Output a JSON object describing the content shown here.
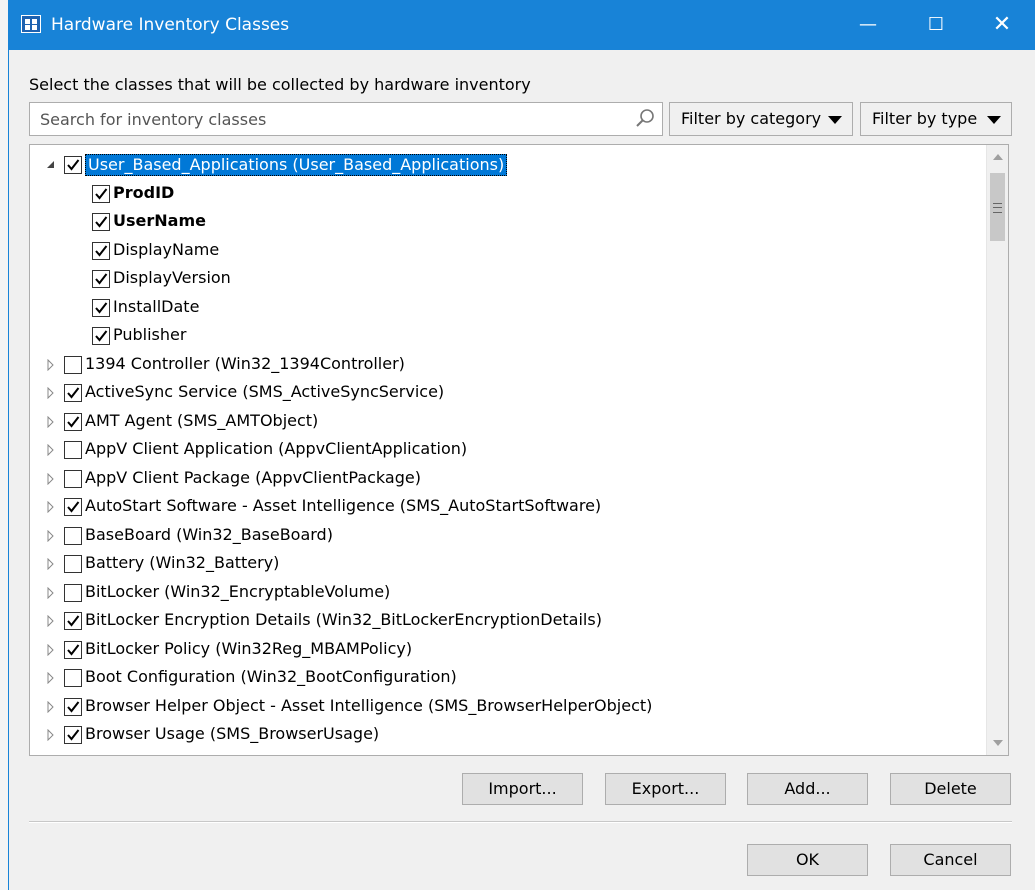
{
  "window": {
    "title": "Hardware Inventory Classes",
    "min_glyph": "—",
    "max_glyph": "☐",
    "close_glyph": "✕"
  },
  "instruction": "Select the classes that will be collected by hardware inventory",
  "search": {
    "placeholder": "Search for inventory classes",
    "value": ""
  },
  "filters": {
    "category_label": "Filter by category",
    "type_label": "Filter by type"
  },
  "tree": {
    "rows": [
      {
        "label": "User_Based_Applications (User_Based_Applications)",
        "checked": true,
        "level": 0,
        "expander": "expanded",
        "selected": true,
        "bold": false
      },
      {
        "label": "ProdID",
        "checked": true,
        "level": 1,
        "expander": "none",
        "selected": false,
        "bold": true
      },
      {
        "label": "UserName",
        "checked": true,
        "level": 1,
        "expander": "none",
        "selected": false,
        "bold": true
      },
      {
        "label": "DisplayName",
        "checked": true,
        "level": 1,
        "expander": "none",
        "selected": false,
        "bold": false
      },
      {
        "label": "DisplayVersion",
        "checked": true,
        "level": 1,
        "expander": "none",
        "selected": false,
        "bold": false
      },
      {
        "label": "InstallDate",
        "checked": true,
        "level": 1,
        "expander": "none",
        "selected": false,
        "bold": false
      },
      {
        "label": "Publisher",
        "checked": true,
        "level": 1,
        "expander": "none",
        "selected": false,
        "bold": false
      },
      {
        "label": "1394 Controller (Win32_1394Controller)",
        "checked": false,
        "level": 0,
        "expander": "collapsed",
        "selected": false,
        "bold": false
      },
      {
        "label": "ActiveSync Service (SMS_ActiveSyncService)",
        "checked": true,
        "level": 0,
        "expander": "collapsed",
        "selected": false,
        "bold": false
      },
      {
        "label": "AMT Agent (SMS_AMTObject)",
        "checked": true,
        "level": 0,
        "expander": "collapsed",
        "selected": false,
        "bold": false
      },
      {
        "label": "AppV Client Application (AppvClientApplication)",
        "checked": false,
        "level": 0,
        "expander": "collapsed",
        "selected": false,
        "bold": false
      },
      {
        "label": "AppV Client Package (AppvClientPackage)",
        "checked": false,
        "level": 0,
        "expander": "collapsed",
        "selected": false,
        "bold": false
      },
      {
        "label": "AutoStart Software - Asset Intelligence (SMS_AutoStartSoftware)",
        "checked": true,
        "level": 0,
        "expander": "collapsed",
        "selected": false,
        "bold": false
      },
      {
        "label": "BaseBoard (Win32_BaseBoard)",
        "checked": false,
        "level": 0,
        "expander": "collapsed",
        "selected": false,
        "bold": false
      },
      {
        "label": "Battery (Win32_Battery)",
        "checked": false,
        "level": 0,
        "expander": "collapsed",
        "selected": false,
        "bold": false
      },
      {
        "label": "BitLocker (Win32_EncryptableVolume)",
        "checked": false,
        "level": 0,
        "expander": "collapsed",
        "selected": false,
        "bold": false
      },
      {
        "label": "BitLocker Encryption Details (Win32_BitLockerEncryptionDetails)",
        "checked": true,
        "level": 0,
        "expander": "collapsed",
        "selected": false,
        "bold": false
      },
      {
        "label": "BitLocker Policy (Win32Reg_MBAMPolicy)",
        "checked": true,
        "level": 0,
        "expander": "collapsed",
        "selected": false,
        "bold": false
      },
      {
        "label": "Boot Configuration (Win32_BootConfiguration)",
        "checked": false,
        "level": 0,
        "expander": "collapsed",
        "selected": false,
        "bold": false
      },
      {
        "label": "Browser Helper Object - Asset Intelligence (SMS_BrowserHelperObject)",
        "checked": true,
        "level": 0,
        "expander": "collapsed",
        "selected": false,
        "bold": false
      },
      {
        "label": "Browser Usage (SMS_BrowserUsage)",
        "checked": true,
        "level": 0,
        "expander": "collapsed",
        "selected": false,
        "bold": false
      }
    ]
  },
  "buttons": {
    "import": "Import...",
    "export": "Export...",
    "add": "Add...",
    "delete": "Delete",
    "ok": "OK",
    "cancel": "Cancel"
  },
  "icons": {
    "app": "hardware-inventory-icon",
    "search": "search-icon",
    "expanded": "triangle-expanded-icon",
    "collapsed": "triangle-collapsed-icon"
  },
  "colors": {
    "titlebar": "#1883d7",
    "selection": "#0078d7"
  }
}
